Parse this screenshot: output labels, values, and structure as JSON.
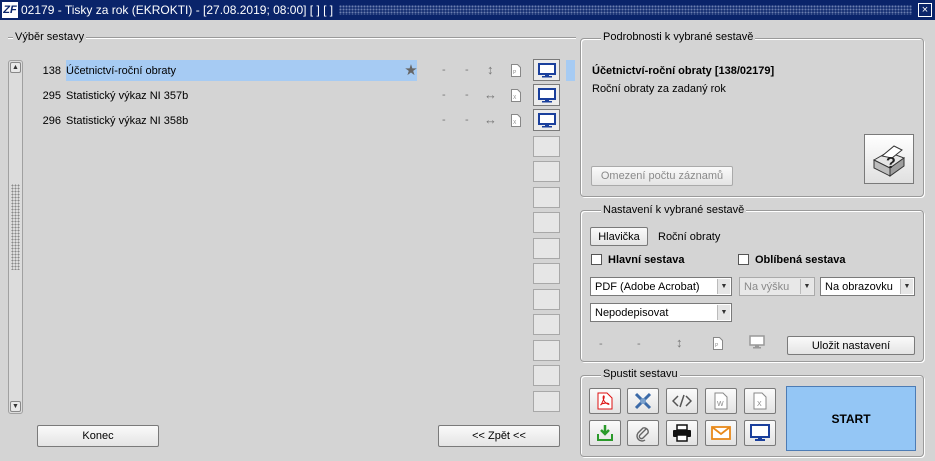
{
  "window": {
    "title": "02179 - Tisky za rok (EKROKTI) - [27.08.2019; 08:00]  [ ]  [ ]",
    "logo": "ZF",
    "close": "×"
  },
  "left": {
    "group_title": "Výběr sestavy",
    "rows": [
      {
        "num": "138",
        "name": "Účetnictví-roční obraty",
        "starred": true,
        "d1": "-",
        "d2": "-",
        "orient": "↕"
      },
      {
        "num": "295",
        "name": "Statistický výkaz NI 357b",
        "starred": false,
        "d1": "-",
        "d2": "-",
        "orient": "↔"
      },
      {
        "num": "296",
        "name": "Statistický výkaz NI 358b",
        "starred": false,
        "d1": "-",
        "d2": "-",
        "orient": "↔"
      }
    ],
    "konec": "Konec",
    "zpet": "<< Zpět <<"
  },
  "details": {
    "group_title": "Podrobnosti k vybrané sestavě",
    "heading": "Účetnictví-roční obraty [138/02179]",
    "description": "Roční obraty za zadaný rok",
    "limit_button": "Omezení počtu záznamů"
  },
  "settings": {
    "group_title": "Nastavení k vybrané sestavě",
    "header_button": "Hlavička",
    "header_value": "Roční obraty",
    "main_label": "Hlavní sestava",
    "fav_label": "Oblíbená sestava",
    "format": "PDF (Adobe Acrobat)",
    "orientation": "Na výšku",
    "output": "Na obrazovku",
    "sign": "Nepodepisovat",
    "d1": "-",
    "d2": "-",
    "save_button": "Uložit nastavení"
  },
  "run": {
    "group_title": "Spustit sestavu",
    "start": "START"
  },
  "colors": {
    "accent": "#94c6f5",
    "selection": "#a6cbf3",
    "title_bar": "#0a246a"
  }
}
